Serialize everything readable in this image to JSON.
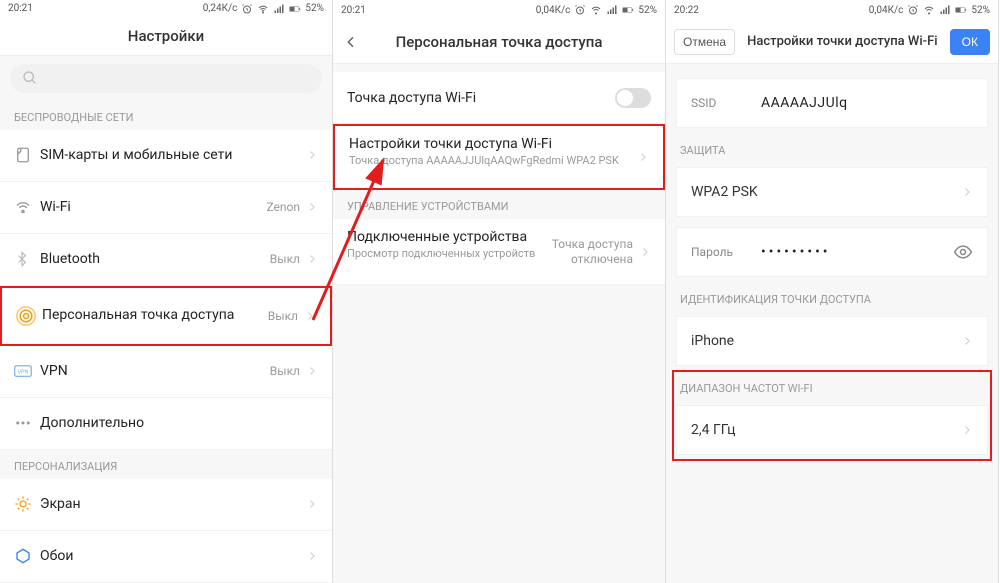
{
  "status": {
    "time1": "20:21",
    "time2": "20:21",
    "time3": "20:22",
    "rate1": "0,24К/с",
    "rate2": "0,04К/с",
    "rate3": "0,04К/с",
    "battery": "52%"
  },
  "p1": {
    "title": "Настройки",
    "section_wireless": "БЕСПРОВОДНЫЕ СЕТИ",
    "sim": "SIM-карты и мобильные сети",
    "wifi": "Wi-Fi",
    "wifi_val": "Zenon",
    "bt": "Bluetooth",
    "bt_val": "Выкл",
    "hotspot": "Персональная точка доступа",
    "hotspot_val": "Выкл",
    "vpn": "VPN",
    "vpn_val": "Выкл",
    "more": "Дополнительно",
    "section_personal": "ПЕРСОНАЛИЗАЦИЯ",
    "display": "Экран",
    "wallpaper": "Обои"
  },
  "p2": {
    "title": "Персональная точка доступа",
    "ap": "Точка доступа Wi-Fi",
    "ap_settings": "Настройки точки доступа Wi-Fi",
    "ap_settings_sub": "Точка доступа AAAAAJJUlqAAQwFgRedmi WPA2 PSK",
    "section_mgmt": "УПРАВЛЕНИЕ УСТРОЙСТВАМИ",
    "connected": "Подключенные устройства",
    "connected_sub": "Просмотр подключенных устройств",
    "connected_val": "Точка доступа отключена"
  },
  "p3": {
    "cancel": "Отмена",
    "ok": "ОК",
    "title": "Настройки точки доступа Wi-Fi",
    "ssid_label": "SSID",
    "ssid_val": "AAAAAJJUlq",
    "section_security": "ЗАЩИТА",
    "security_val": "WPA2 PSK",
    "pwd_label": "Пароль",
    "pwd_val": "•••••••••",
    "section_ident": "ИДЕНТИФИКАЦИЯ ТОЧКИ ДОСТУПА",
    "ident_val": "iPhone",
    "section_band": "ДИАПАЗОН ЧАСТОТ WI-FI",
    "band_val": "2,4 ГГц"
  }
}
